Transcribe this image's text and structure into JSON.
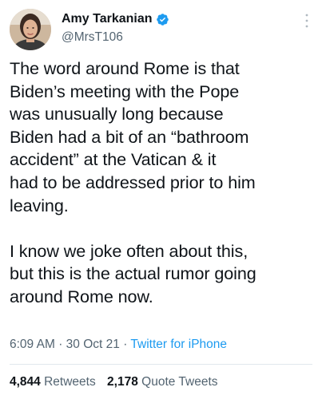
{
  "author": {
    "display_name": "Amy Tarkanian",
    "handle": "@MrsT106",
    "verified": true,
    "avatar_icon": "profile-photo"
  },
  "tweet": {
    "paragraphs": [
      [
        "The word around Rome is that",
        "Biden’s meeting with the Pope",
        "was unusually long because",
        "Biden had a bit of an “bathroom",
        "accident” at the Vatican & it",
        "had to be addressed prior to him",
        "leaving."
      ],
      [
        "I know we joke often about this,",
        "but this is the actual rumor going",
        "around Rome now."
      ]
    ],
    "time": "6:09 AM",
    "separator": "·",
    "date": "30 Oct 21",
    "source": "Twitter for iPhone"
  },
  "stats": {
    "retweets_count": "4,844",
    "retweets_label": "Retweets",
    "quote_tweets_count": "2,178",
    "quote_tweets_label": "Quote Tweets"
  },
  "colors": {
    "text": "#0f1419",
    "secondary": "#536471",
    "link": "#1d9bf0",
    "verified": "#1d9bf0"
  }
}
